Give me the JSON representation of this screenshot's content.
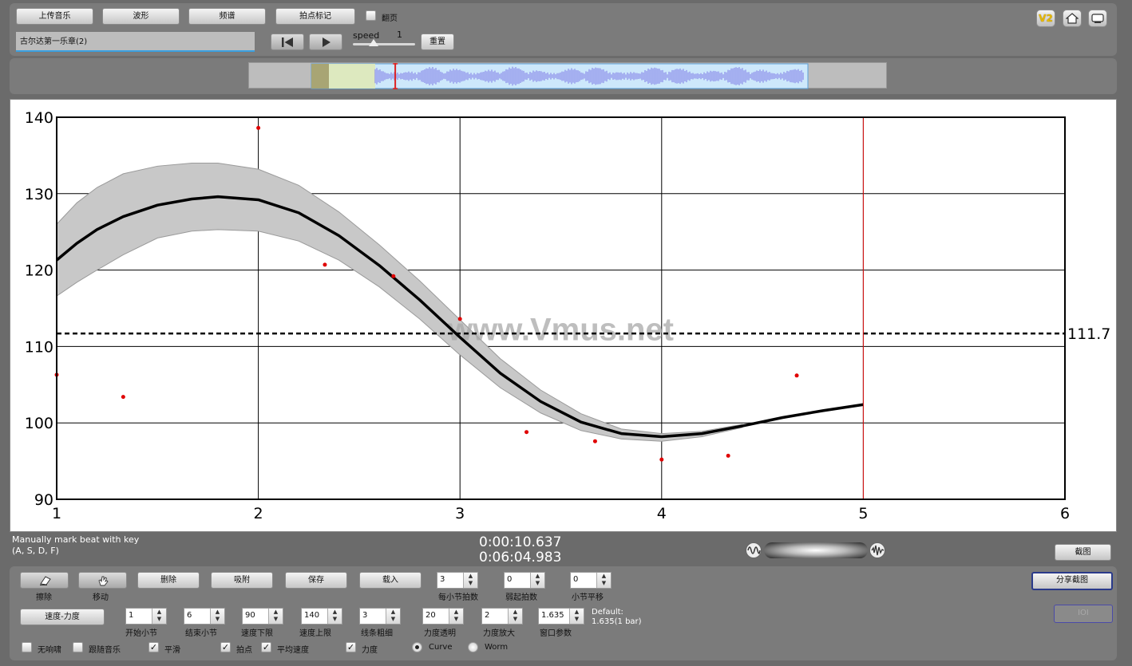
{
  "top": {
    "upload_label": "上传音乐",
    "waveform_label": "波形",
    "spectrum_label": "频谱",
    "beat_mark_label": "拍点标记",
    "page_turn_label": "翻页",
    "page_turn_checked": false,
    "track_title": "古尔达第一乐章(2)",
    "speed_label": "speed",
    "speed_value": "1",
    "reset_label": "重置",
    "icons": [
      "v2-icon",
      "home-icon",
      "screen-icon"
    ],
    "v2_text": "V2"
  },
  "overview": {
    "playhead_fraction": 0.169,
    "window_start_fraction": 0.0,
    "window_end_fraction": 0.262
  },
  "chart_data": {
    "type": "line",
    "xlabel": "",
    "ylabel": "",
    "xlim": [
      1,
      6
    ],
    "ylim": [
      90,
      140
    ],
    "xticks": [
      "1",
      "2",
      "3",
      "4",
      "5",
      "6"
    ],
    "yticks": [
      "90",
      "100",
      "110",
      "120",
      "130",
      "140"
    ],
    "grid": true,
    "average": 111.7,
    "average_label": "111.7",
    "current_position": 5,
    "watermark": "www.Vmus.net",
    "curve": {
      "x": [
        1,
        1.1,
        1.2,
        1.33,
        1.5,
        1.67,
        1.8,
        2,
        2.2,
        2.4,
        2.6,
        2.8,
        3,
        3.2,
        3.4,
        3.6,
        3.8,
        4,
        4.2,
        4.4,
        4.6,
        4.8,
        5
      ],
      "y": [
        121.3,
        123.5,
        125.3,
        127.0,
        128.5,
        129.3,
        129.6,
        129.2,
        127.5,
        124.5,
        120.6,
        116.1,
        111.2,
        106.5,
        102.8,
        100.1,
        98.6,
        98.2,
        98.6,
        99.6,
        100.7,
        101.6,
        102.4
      ]
    },
    "band": {
      "upper": [
        126.0,
        128.8,
        130.8,
        132.6,
        133.6,
        134.0,
        134.0,
        133.2,
        131.1,
        127.6,
        123.3,
        118.6,
        113.5,
        108.4,
        104.3,
        101.2,
        99.2,
        98.6,
        98.9,
        99.8
      ],
      "lower": [
        116.6,
        118.4,
        120.0,
        122.0,
        124.2,
        125.1,
        125.3,
        125.1,
        123.8,
        121.3,
        117.8,
        113.6,
        108.9,
        104.6,
        101.3,
        99.0,
        97.9,
        97.6,
        98.2,
        99.4
      ],
      "x": [
        1,
        1.1,
        1.2,
        1.33,
        1.5,
        1.67,
        1.8,
        2,
        2.2,
        2.4,
        2.6,
        2.8,
        3,
        3.2,
        3.4,
        3.6,
        3.8,
        4,
        4.2,
        4.4
      ]
    },
    "beats": {
      "x": [
        1,
        1.33,
        2,
        2.33,
        2.67,
        3,
        3.33,
        3.67,
        4,
        4.33,
        4.67
      ],
      "y": [
        106.3,
        103.4,
        138.6,
        120.7,
        119.2,
        113.6,
        98.8,
        97.6,
        95.2,
        95.7,
        106.2
      ]
    }
  },
  "status": {
    "hint_line1": "Manually mark beat with key",
    "hint_line2": "(A, S, D, F)",
    "time_current": "0:00:10.637",
    "time_total": "0:06:04.983",
    "screenshot_label": "截图"
  },
  "controls": {
    "erase_label": "擦除",
    "move_label": "移动",
    "delete_label": "删除",
    "snap_label": "吸附",
    "save_label": "保存",
    "load_label": "载入",
    "share_label": "分享截图",
    "ioi_label": "IOI",
    "tempo_dynamics_label": "速度-力度",
    "beats_per_bar": {
      "label": "每小节拍数",
      "value": "3"
    },
    "pickup_beats": {
      "label": "弱起拍数",
      "value": "0"
    },
    "bar_shift": {
      "label": "小节平移",
      "value": "0"
    },
    "start_bar": {
      "label": "开始小节",
      "value": "1"
    },
    "end_bar": {
      "label": "结束小节",
      "value": "6"
    },
    "tempo_min": {
      "label": "速度下限",
      "value": "90"
    },
    "tempo_max": {
      "label": "速度上限",
      "value": "140"
    },
    "line_width": {
      "label": "线条粗细",
      "value": "3"
    },
    "dyn_opacity": {
      "label": "力度透明",
      "value": "20"
    },
    "dyn_scale": {
      "label": "力度放大",
      "value": "2"
    },
    "window_param": {
      "label": "窗口参数",
      "value": "1.635"
    },
    "default_line1": "Default:",
    "default_line2": "1.635(1 bar)",
    "options": [
      {
        "label": "无响啸",
        "checked": false
      },
      {
        "label": "跟随音乐",
        "checked": false
      },
      {
        "label": "平滑",
        "checked": true
      },
      {
        "label": "拍点",
        "checked": true
      },
      {
        "label": "平均速度",
        "checked": true
      },
      {
        "label": "力度",
        "checked": true
      }
    ],
    "mode_curve": "Curve",
    "mode_worm": "Worm",
    "mode_selected": "Curve"
  }
}
